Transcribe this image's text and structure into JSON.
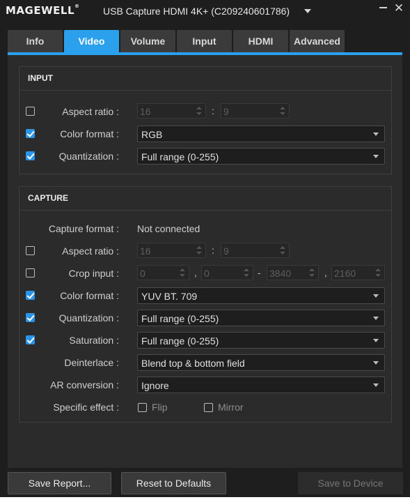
{
  "titlebar": {
    "logo": "MAGEWELL",
    "logo_mark": "®",
    "device": "USB Capture HDMI 4K+ (C209240601786)",
    "minimize_glyph": "—",
    "close_glyph": "✕"
  },
  "tabs": [
    {
      "label": "Info",
      "active": false
    },
    {
      "label": "Video",
      "active": true
    },
    {
      "label": "Volume",
      "active": false
    },
    {
      "label": "Input",
      "active": false
    },
    {
      "label": "HDMI",
      "active": false
    },
    {
      "label": "Advanced",
      "active": false
    }
  ],
  "input": {
    "header": "INPUT",
    "aspect_ratio": {
      "label": "Aspect ratio :",
      "checked": false,
      "w": "16",
      "h": "9",
      "sep": ":"
    },
    "color_format": {
      "label": "Color format :",
      "checked": true,
      "value": "RGB"
    },
    "quantization": {
      "label": "Quantization :",
      "checked": true,
      "value": "Full range (0-255)"
    }
  },
  "capture": {
    "header": "CAPTURE",
    "capture_format": {
      "label": "Capture format :",
      "value": "Not connected"
    },
    "aspect_ratio": {
      "label": "Aspect ratio :",
      "checked": false,
      "w": "16",
      "h": "9",
      "sep": ":"
    },
    "crop_input": {
      "label": "Crop input :",
      "checked": false,
      "x": "0",
      "y": "0",
      "w": "3840",
      "h": "2160",
      "sep1": ",",
      "sep2": "-",
      "sep3": ","
    },
    "color_format": {
      "label": "Color format :",
      "checked": true,
      "value": "YUV BT. 709"
    },
    "quantization": {
      "label": "Quantization :",
      "checked": true,
      "value": "Full range (0-255)"
    },
    "saturation": {
      "label": "Saturation :",
      "checked": true,
      "value": "Full range (0-255)"
    },
    "deinterlace": {
      "label": "Deinterlace :",
      "value": "Blend top & bottom field"
    },
    "ar_conversion": {
      "label": "AR conversion :",
      "value": "Ignore"
    },
    "specific_effect": {
      "label": "Specific effect :",
      "flip": "Flip",
      "mirror": "Mirror"
    }
  },
  "buttons": {
    "save_report": "Save Report...",
    "reset": "Reset to Defaults",
    "save_device": "Save to Device"
  },
  "colors": {
    "accent": "#2ba0ec",
    "background": "#1e1e1e",
    "panel": "#2b2b2b"
  }
}
